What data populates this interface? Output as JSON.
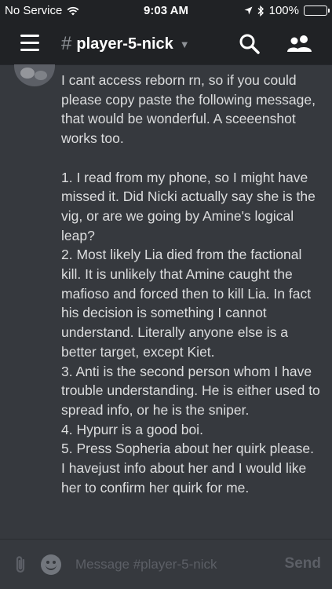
{
  "status_bar": {
    "carrier": "No Service",
    "time": "9:03 AM",
    "battery": "100%"
  },
  "header": {
    "channel_name": "player-5-nick",
    "icons": [
      "menu-icon",
      "hash-icon",
      "chevron-down-icon",
      "search-icon",
      "members-icon"
    ]
  },
  "message": {
    "text": "I cant access reborn rn, so if you could please copy paste the following message, that would be wonderful. A sceeenshot works too.\n\n1. I read from my phone, so I might have missed it. Did Nicki actually say she is the vig, or are we going by Amine's logical leap?\n2. Most likely Lia died from the factional kill. It is unlikely that Amine caught the mafioso and forced then to kill Lia. In fact his decision is something I cannot understand. Literally anyone else is a better target, except Kiet.\n3. Anti is the second person whom I have trouble understanding. He is either used to spread info, or he is the sniper.\n4. Hypurr is a good boi.\n5. Press Sopheria about her quirk please.\nI havejust info about her and I would like her to confirm her quirk for me."
  },
  "composer": {
    "placeholder": "Message #player-5-nick",
    "value": "",
    "send_label": "Send"
  },
  "colors": {
    "background": "#36393e",
    "header": "#202225",
    "text": "#dcddde",
    "muted": "#5c5f66"
  }
}
